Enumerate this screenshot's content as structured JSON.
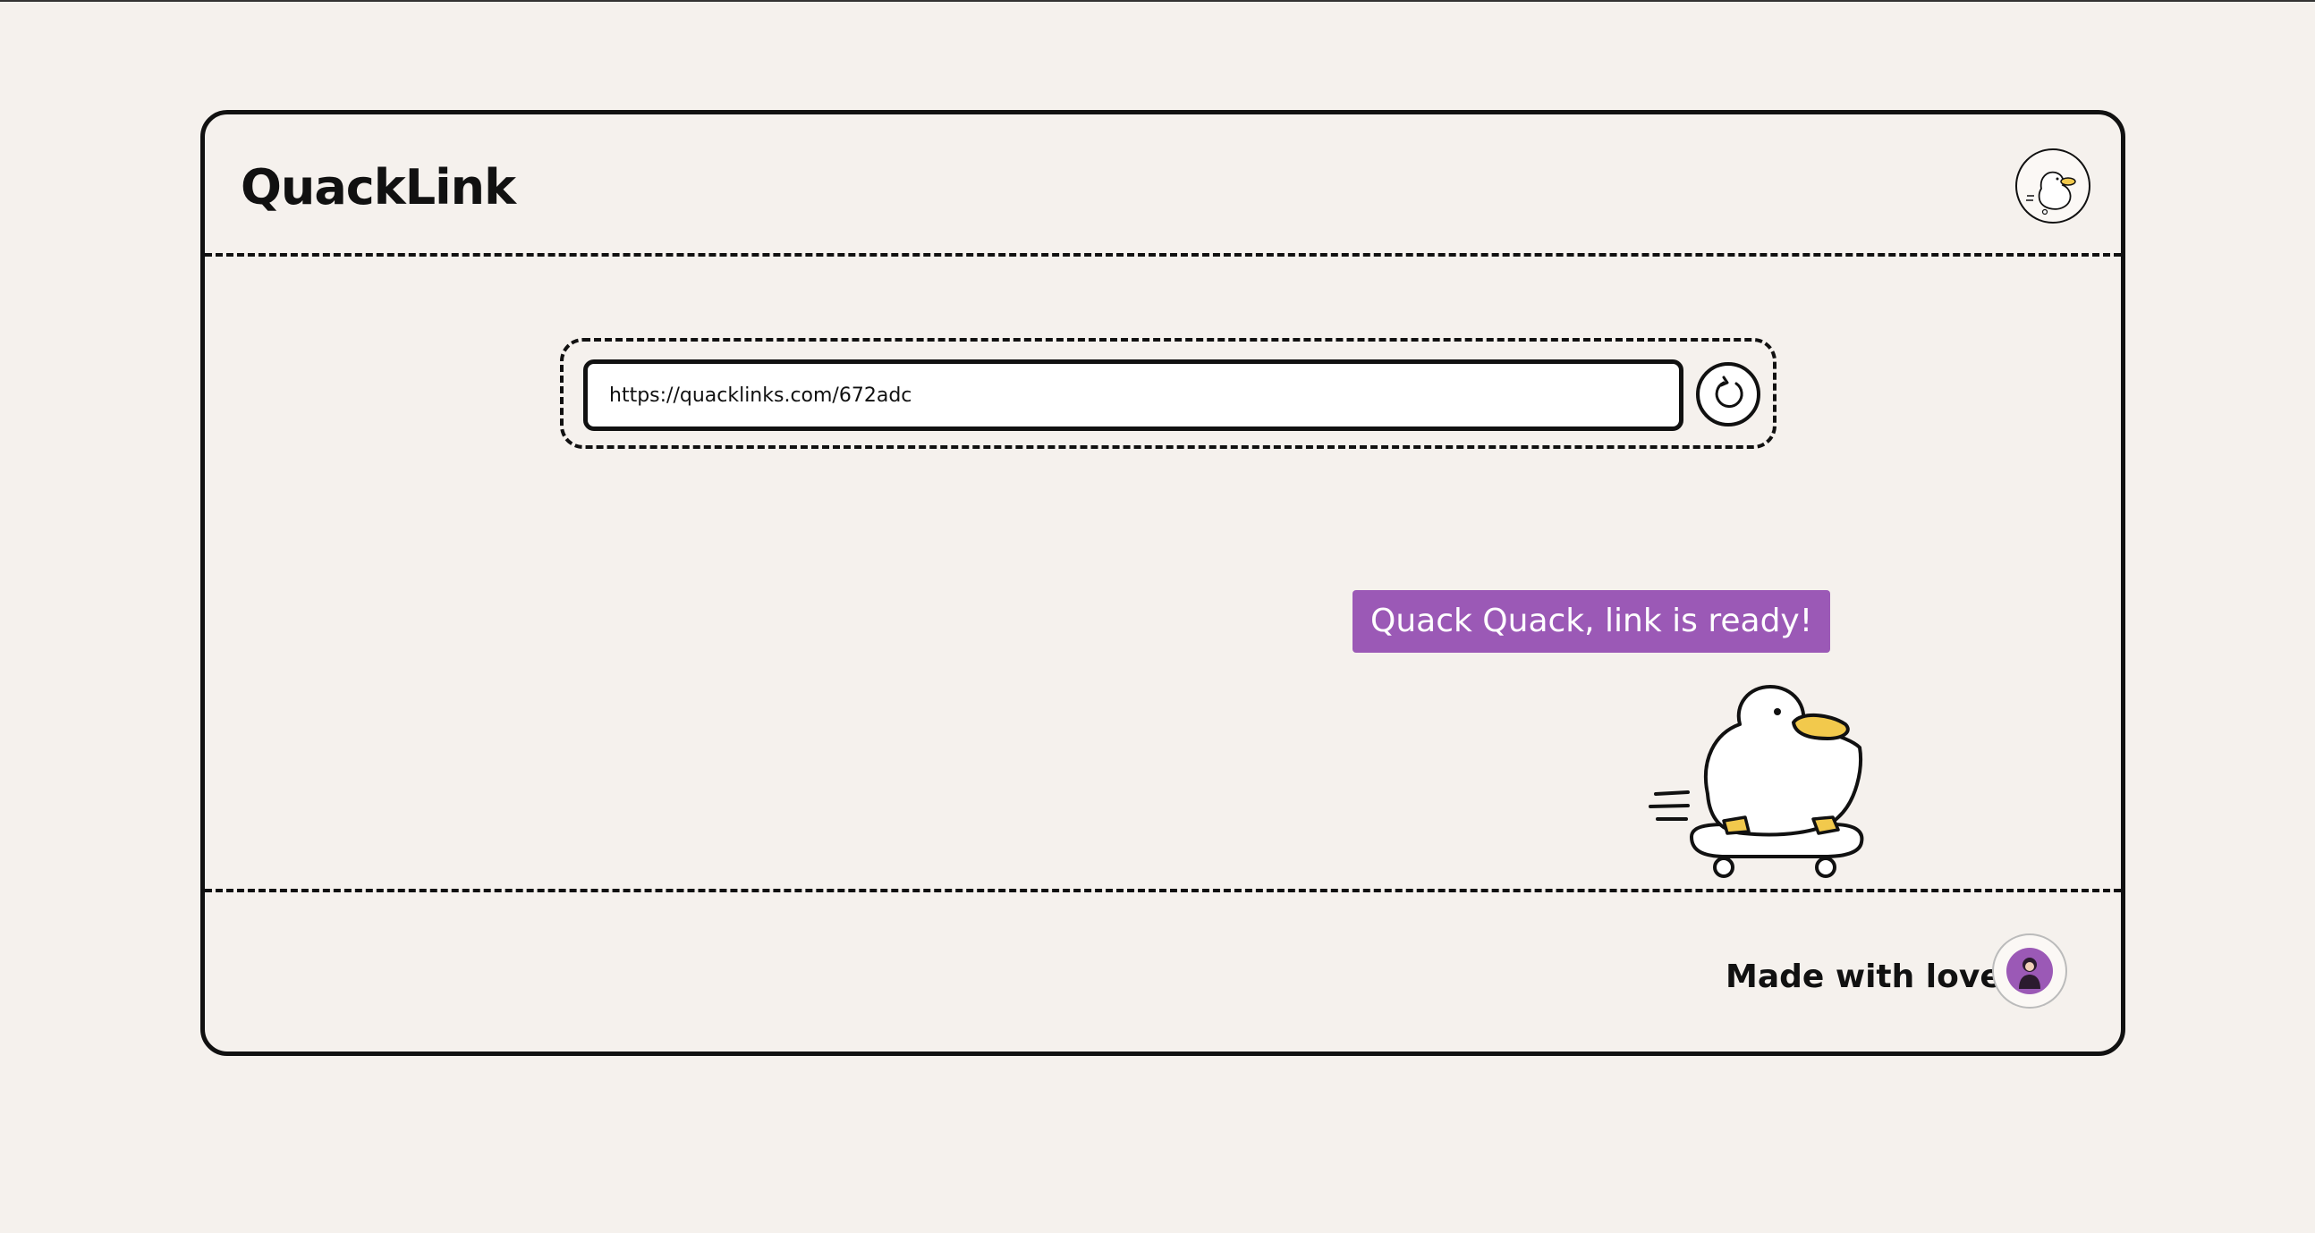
{
  "app": {
    "title": "QuackLink"
  },
  "url_bar": {
    "value": "https://quacklinks.com/672adc",
    "refresh_icon": "refresh-icon"
  },
  "toast": {
    "message": "Quack Quack, link is ready!"
  },
  "footer": {
    "text": "Made with love by"
  },
  "colors": {
    "background": "#f5f1ed",
    "accent": "#9b59b6",
    "border": "#111111",
    "duck_beak": "#f2c94c"
  }
}
